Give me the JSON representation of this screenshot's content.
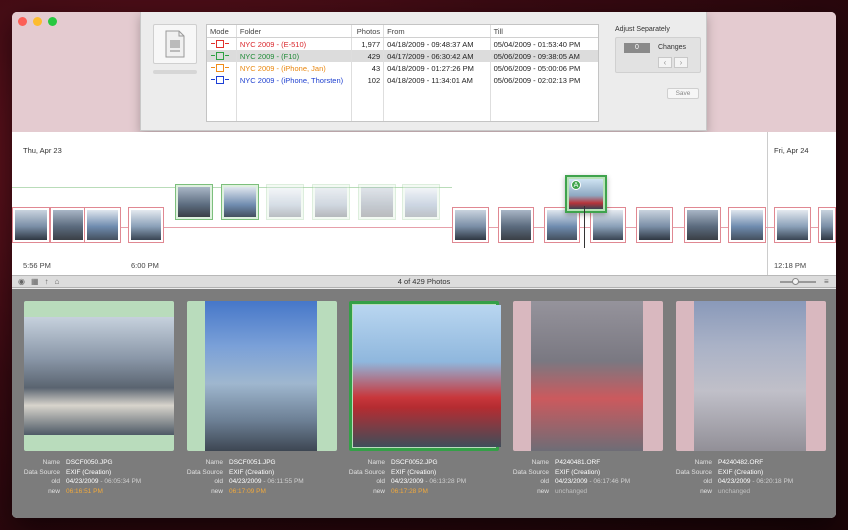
{
  "window": {
    "traffic_lights": [
      "close",
      "minimize",
      "maximize"
    ]
  },
  "import_sheet": {
    "columns": [
      "Mode",
      "Folder",
      "Photos",
      "From",
      "Till"
    ],
    "rows": [
      {
        "mode_color": "#e0302a",
        "folder": "NYC 2009 - (E-510)",
        "folder_color": "#d9262b",
        "photos": "1,977",
        "from": "04/18/2009 - 09:48:37 AM",
        "till": "05/04/2009 - 01:53:40 PM"
      },
      {
        "mode_color": "#2ea043",
        "folder": "NYC 2009 - (F10)",
        "folder_color": "#1f8a36",
        "photos": "429",
        "from": "04/17/2009 - 06:30:42 AM",
        "till": "05/06/2009 - 09:38:05 AM"
      },
      {
        "mode_color": "#f08c1a",
        "folder": "NYC 2009 - (iPhone, Jan)",
        "folder_color": "#e9870f",
        "photos": "43",
        "from": "04/18/2009 - 01:27:26 PM",
        "till": "05/06/2009 - 05:00:06 PM"
      },
      {
        "mode_color": "#1c3fd6",
        "folder": "NYC 2009 - (iPhone, Thorsten)",
        "folder_color": "#1d3fcf",
        "photos": "102",
        "from": "04/18/2009 - 11:34:01 AM",
        "till": "05/06/2009 - 02:02:13 PM"
      }
    ],
    "adjust": {
      "title": "Adjust Separately",
      "count": "0",
      "changes_label": "Changes",
      "prev_icon": "chevron-left-icon",
      "next_icon": "chevron-right-icon",
      "save_label": "Save"
    }
  },
  "timeline": {
    "left_date": "Thu, Apr 23",
    "right_date": "Fri, Apr 24",
    "times": [
      "5:56 PM",
      "6:00 PM",
      "12:18 PM"
    ],
    "badge": "A"
  },
  "toolbar": {
    "count_label": "4 of 429 Photos",
    "icons": [
      "eye-icon",
      "grid-icon",
      "arrow-up-icon",
      "tray-icon",
      "list-icon"
    ]
  },
  "gallery": {
    "labels": {
      "name": "Name",
      "data_source": "Data Source",
      "old": "old",
      "new": "new"
    },
    "items": [
      {
        "name": "DSCF0050.JPG",
        "data_source": "EXIF (Creation)",
        "old_date": "04/23/2009",
        "old_time": "- 06:05:34 PM",
        "new_value": "06:16:51 PM",
        "new_style": "orange",
        "style": "green"
      },
      {
        "name": "DSCF0051.JPG",
        "data_source": "EXIF (Creation)",
        "old_date": "04/23/2009",
        "old_time": "- 06:11:55 PM",
        "new_value": "06:17:09 PM",
        "new_style": "orange",
        "style": "green"
      },
      {
        "name": "DSCF0052.JPG",
        "data_source": "EXIF (Creation)",
        "old_date": "04/23/2009",
        "old_time": "- 06:13:28 PM",
        "new_value": "06:17:28 PM",
        "new_style": "orange",
        "style": "selected"
      },
      {
        "name": "P4240481.ORF",
        "data_source": "EXIF (Creation)",
        "old_date": "04/23/2009",
        "old_time": "- 06:17:46 PM",
        "new_value": "unchanged",
        "new_style": "dimgray",
        "style": "pink"
      },
      {
        "name": "P4240482.ORF",
        "data_source": "EXIF (Creation)",
        "old_date": "04/23/2009",
        "old_time": "- 06:20:18 PM",
        "new_value": "unchanged",
        "new_style": "dimgray",
        "style": "pink"
      }
    ]
  }
}
